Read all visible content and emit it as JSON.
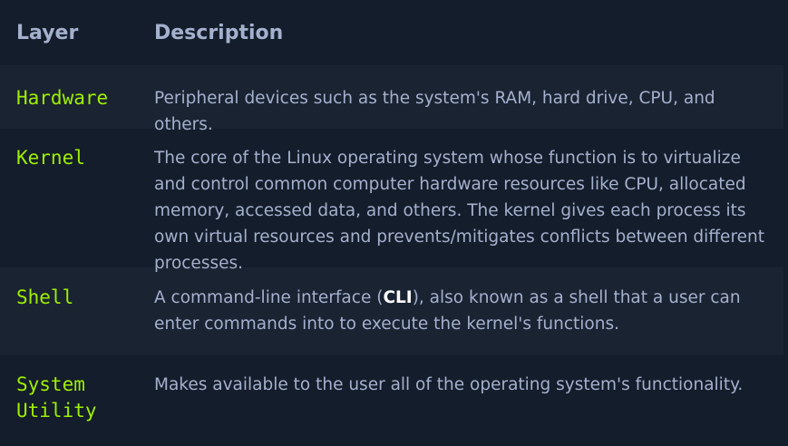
{
  "header": {
    "layer": "Layer",
    "description": "Description"
  },
  "rows": [
    {
      "layer": "Hardware",
      "description": "Peripheral devices such as the system's RAM, hard drive, CPU, and others."
    },
    {
      "layer": "Kernel",
      "description": "The core of the Linux operating system whose function is to virtualize and control common computer hardware resources like CPU, allocated memory, accessed data, and others. The kernel gives each process its own virtual resources and prevents/mitigates conflicts between different processes."
    },
    {
      "layer": "Shell",
      "description_pre": "A command-line interface (",
      "description_bold": "CLI",
      "description_post": "), also known as a shell that a user can enter commands into to execute the kernel's functions."
    },
    {
      "layer": "System Utility",
      "description": "Makes available to the user all of the operating system's functionality."
    }
  ],
  "colors": {
    "background": "#141d2b",
    "row_alt": "#1a2332",
    "layer_text": "#9fef00",
    "body_text": "#a4b1cd"
  }
}
